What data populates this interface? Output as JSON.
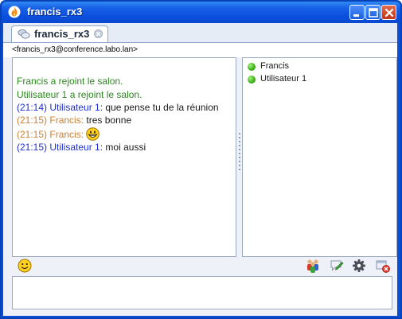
{
  "window": {
    "title": "francis_rx3",
    "icons": {
      "app": "flame-icon",
      "minimize": "minimize-icon",
      "maximize": "maximize-icon",
      "close": "close-icon"
    }
  },
  "tab": {
    "label": "francis_rx3",
    "icon": "chat-bubbles-icon",
    "close_icon": "close-tab-icon"
  },
  "room": {
    "jid": "<francis_rx3@conference.labo.lan>"
  },
  "chat": {
    "messages": [
      {
        "text": "Francis a rejoint le salon."
      },
      {
        "text": "Utilisateur 1 a rejoint le salon."
      },
      {
        "time": "(21:14)",
        "sender": "Utilisateur 1:",
        "body": "que pense tu de la réunion"
      },
      {
        "time": "(21:15)",
        "sender": "Francis:",
        "body": "tres bonne"
      },
      {
        "time": "(21:15)",
        "sender": "Francis:",
        "emoticon": "grinning-emoticon-icon"
      },
      {
        "time": "(21:15)",
        "sender": "Utilisateur 1:",
        "body": "moi aussi"
      }
    ]
  },
  "occupants": [
    {
      "name": "Francis",
      "status": "available",
      "status_color": "#3fb51d"
    },
    {
      "name": "Utilisateur 1",
      "status": "available",
      "status_color": "#3fb51d"
    }
  ],
  "toolbar": {
    "emoticon": "smiley-icon",
    "invite": "invite-users-icon",
    "change_subject": "edit-subject-icon",
    "settings": "gear-icon",
    "leave": "leave-room-icon"
  },
  "compose": {
    "value": ""
  },
  "colors": {
    "join_notice": "#2a8a1d",
    "user1": "#1d2fd1",
    "francis": "#c98135",
    "titlebar": "#0b4fdc"
  }
}
